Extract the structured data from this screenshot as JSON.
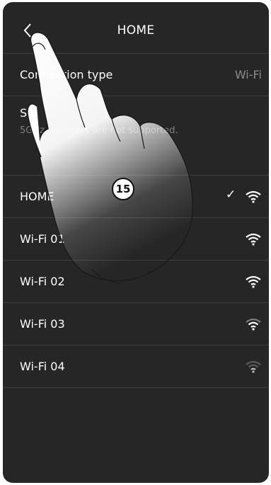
{
  "header": {
    "title": "HOME",
    "back_icon": "chevron-left-icon"
  },
  "connection": {
    "label": "Connection type",
    "value": "Wi-Fi"
  },
  "setup": {
    "label": "Se",
    "note": "5GHz networks are not supported."
  },
  "networks": [
    {
      "name": "HOME",
      "connected": true,
      "signal_bars": 3
    },
    {
      "name": "Wi-Fi 01",
      "connected": false,
      "signal_bars": 3
    },
    {
      "name": "Wi-Fi 02",
      "connected": false,
      "signal_bars": 3
    },
    {
      "name": "Wi-Fi 03",
      "connected": false,
      "signal_bars": 2
    },
    {
      "name": "Wi-Fi 04",
      "connected": false,
      "signal_bars": 1
    }
  ],
  "checkmark": "✓",
  "annotation": {
    "step": "15"
  },
  "colors": {
    "background": "#262626",
    "divider": "#3e3e3e",
    "text": "#ffffff",
    "muted": "#8a8a8a"
  }
}
